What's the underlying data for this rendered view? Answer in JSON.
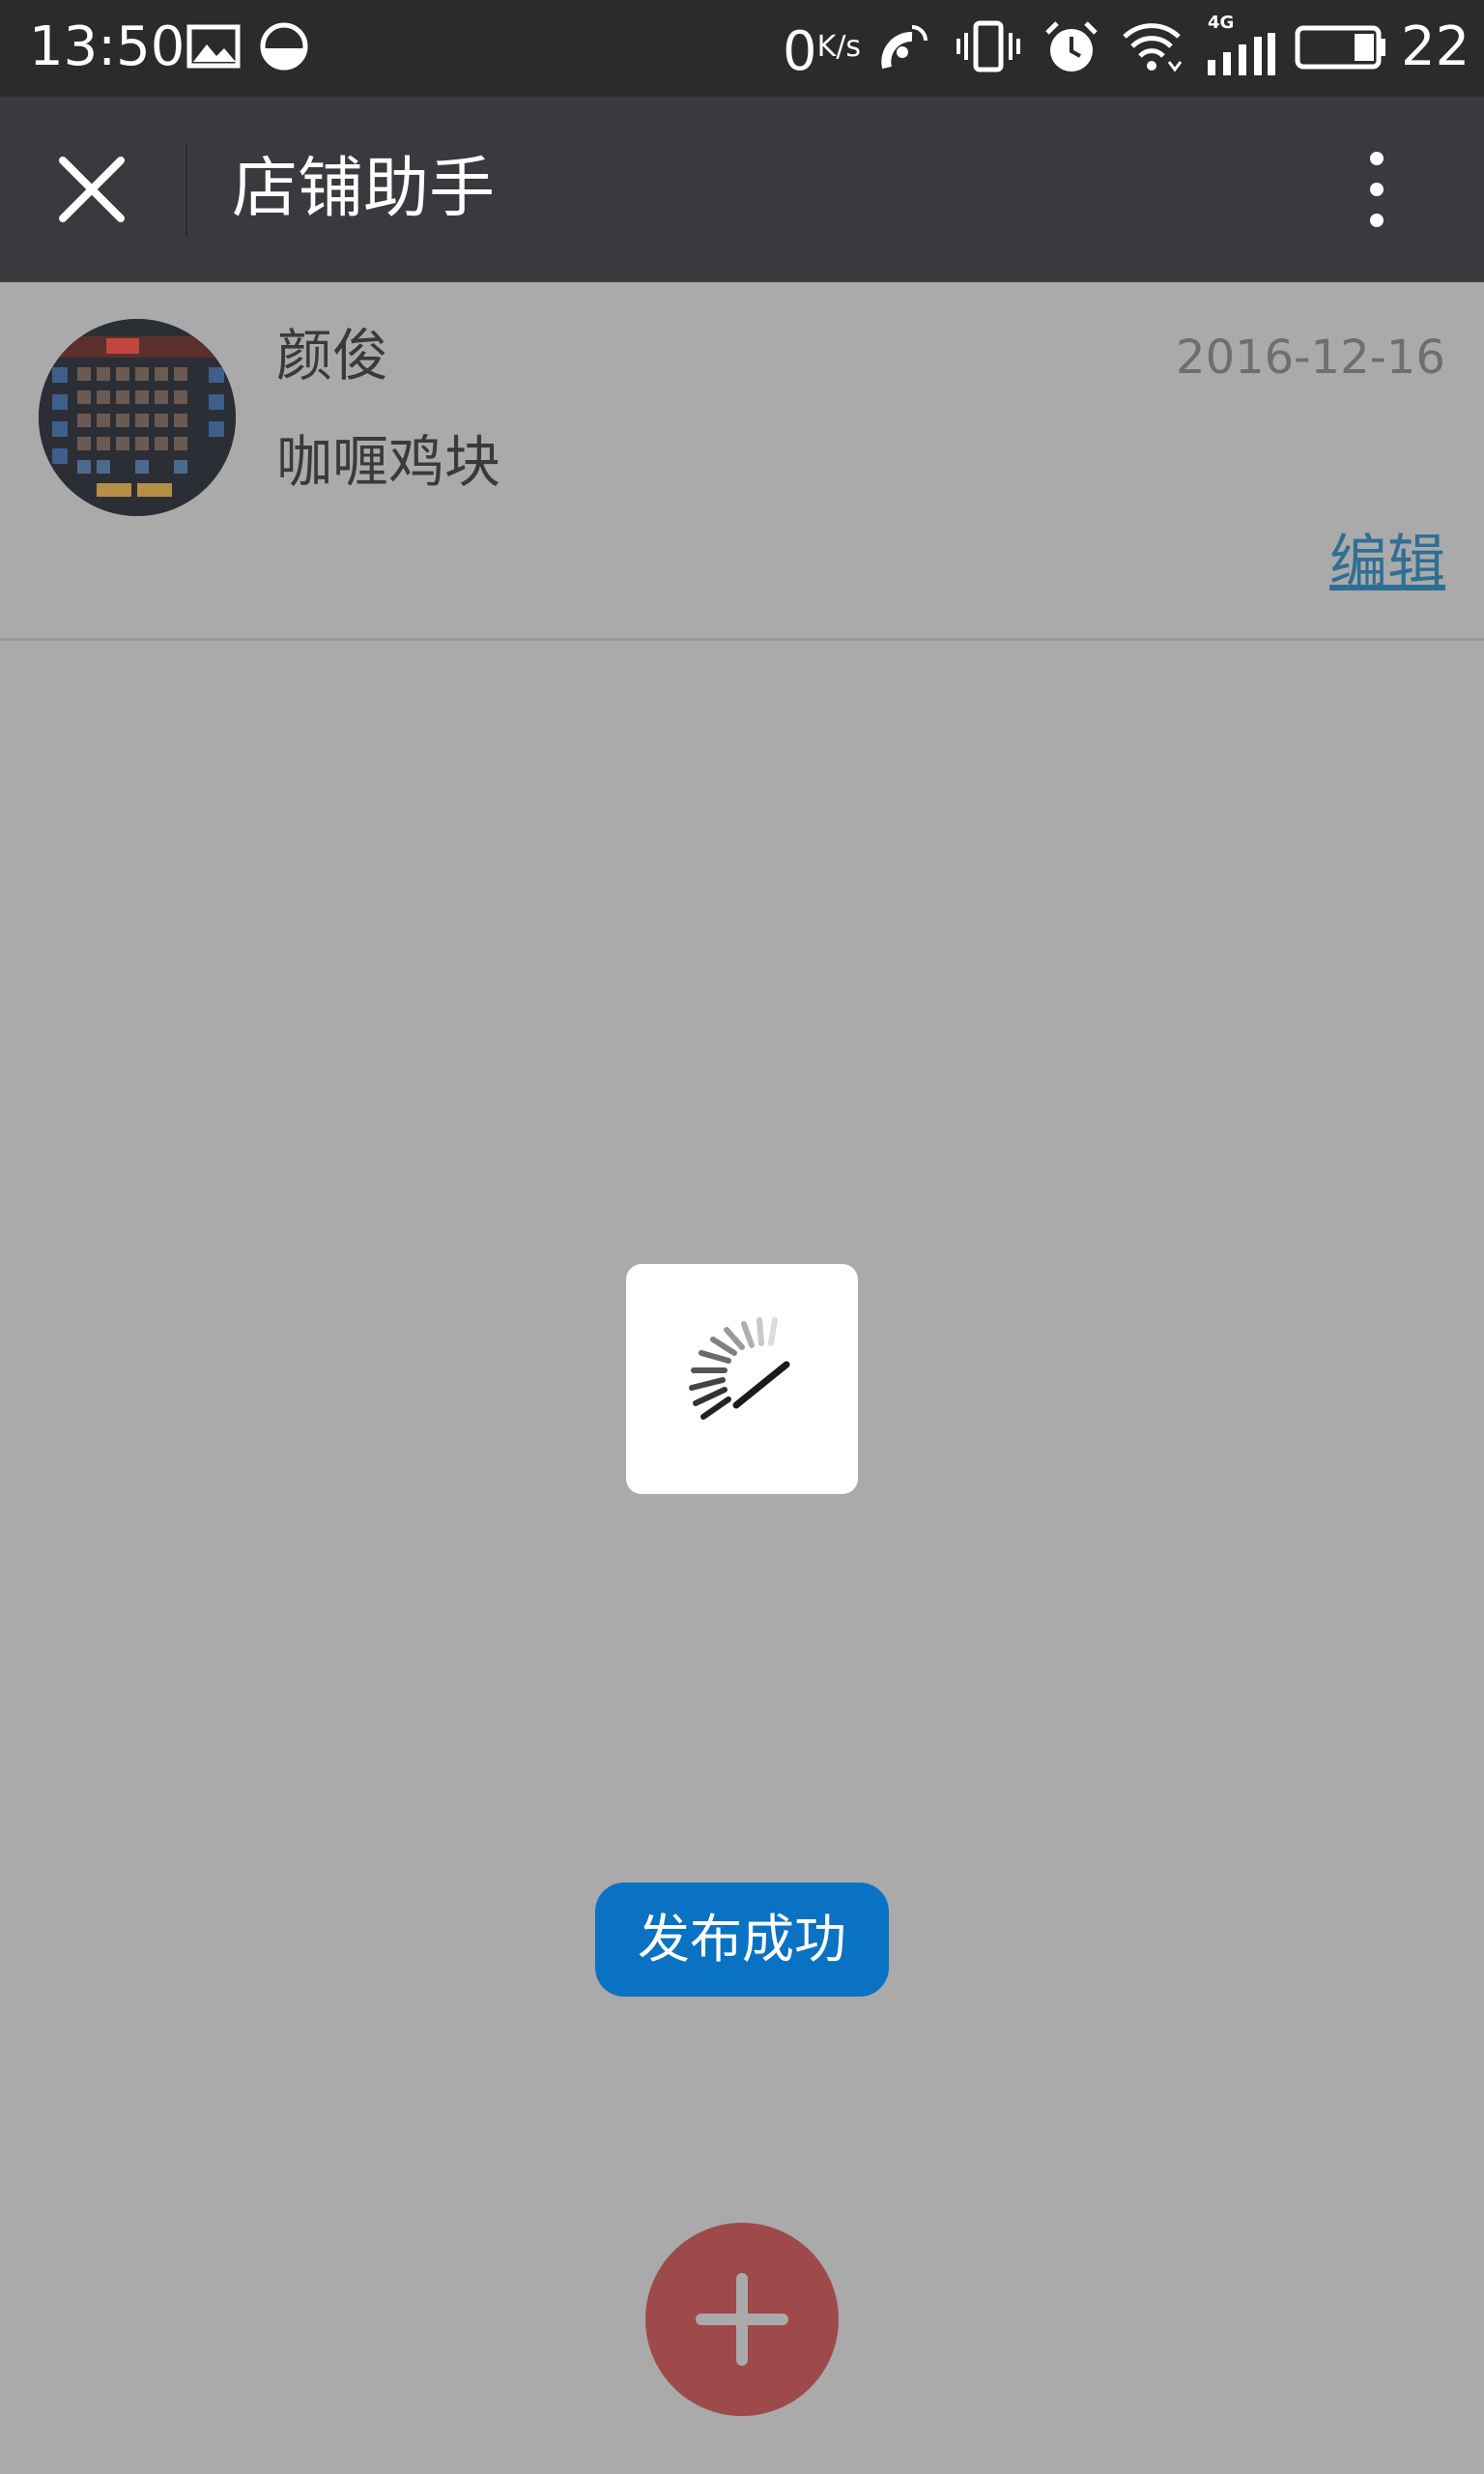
{
  "status_bar": {
    "time": "13:50",
    "net_speed_value": "0",
    "net_speed_unit": "K/s",
    "network_type": "4G",
    "battery_level": "22",
    "icons": [
      "image-icon",
      "data-saver-icon",
      "satellite-icon",
      "vibrate-icon",
      "alarm-icon",
      "wifi-icon",
      "signal-icon",
      "battery-icon"
    ]
  },
  "nav": {
    "title": "店铺助手",
    "close_icon": "close-icon",
    "more_icon": "more-vertical-icon"
  },
  "post": {
    "author": "颜俊",
    "date": "2016-12-16",
    "content": "咖喱鸡块",
    "edit_label": "编辑",
    "edit_color": "#2f6f94"
  },
  "loading": {
    "icon": "spinner-icon"
  },
  "toast": {
    "message": "发布成功",
    "color": "#0a72c2"
  },
  "fab": {
    "icon": "plus-icon",
    "color": "#9e4a4a"
  },
  "overlay": {
    "color": "#aaaaaa"
  }
}
